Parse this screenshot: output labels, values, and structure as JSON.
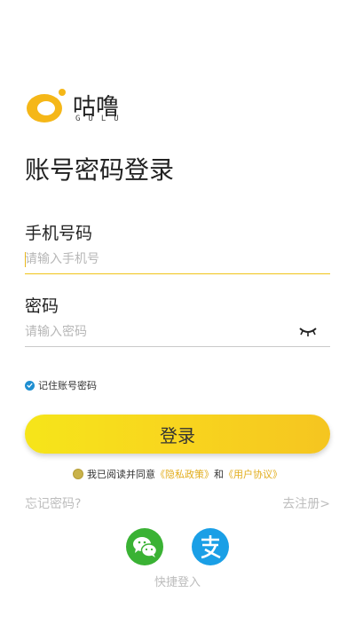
{
  "brand": {
    "name": "咕噜",
    "subtitle": "GULU",
    "logo_color": "#f5b718"
  },
  "page": {
    "title": "账号密码登录"
  },
  "phone": {
    "label": "手机号码",
    "placeholder": "请输入手机号",
    "value": ""
  },
  "password": {
    "label": "密码",
    "placeholder": "请输入密码",
    "value": "",
    "toggle_icon": "eye-closed-icon"
  },
  "remember": {
    "label": "记住账号密码",
    "checked": true
  },
  "login_button": {
    "label": "登录"
  },
  "agreement": {
    "prefix": "我已阅读并同意",
    "privacy": "《隐私政策》",
    "and": "和",
    "terms": "《用户协议》"
  },
  "links": {
    "forgot": "忘记密码?",
    "register": "去注册>"
  },
  "quick_login": {
    "label": "快捷登入",
    "providers": [
      "wechat-icon",
      "alipay-icon"
    ]
  },
  "colors": {
    "accent": "#f8d51e",
    "link": "#e2ad1c",
    "wechat": "#3ab234",
    "alipay": "#1a9fe6"
  }
}
